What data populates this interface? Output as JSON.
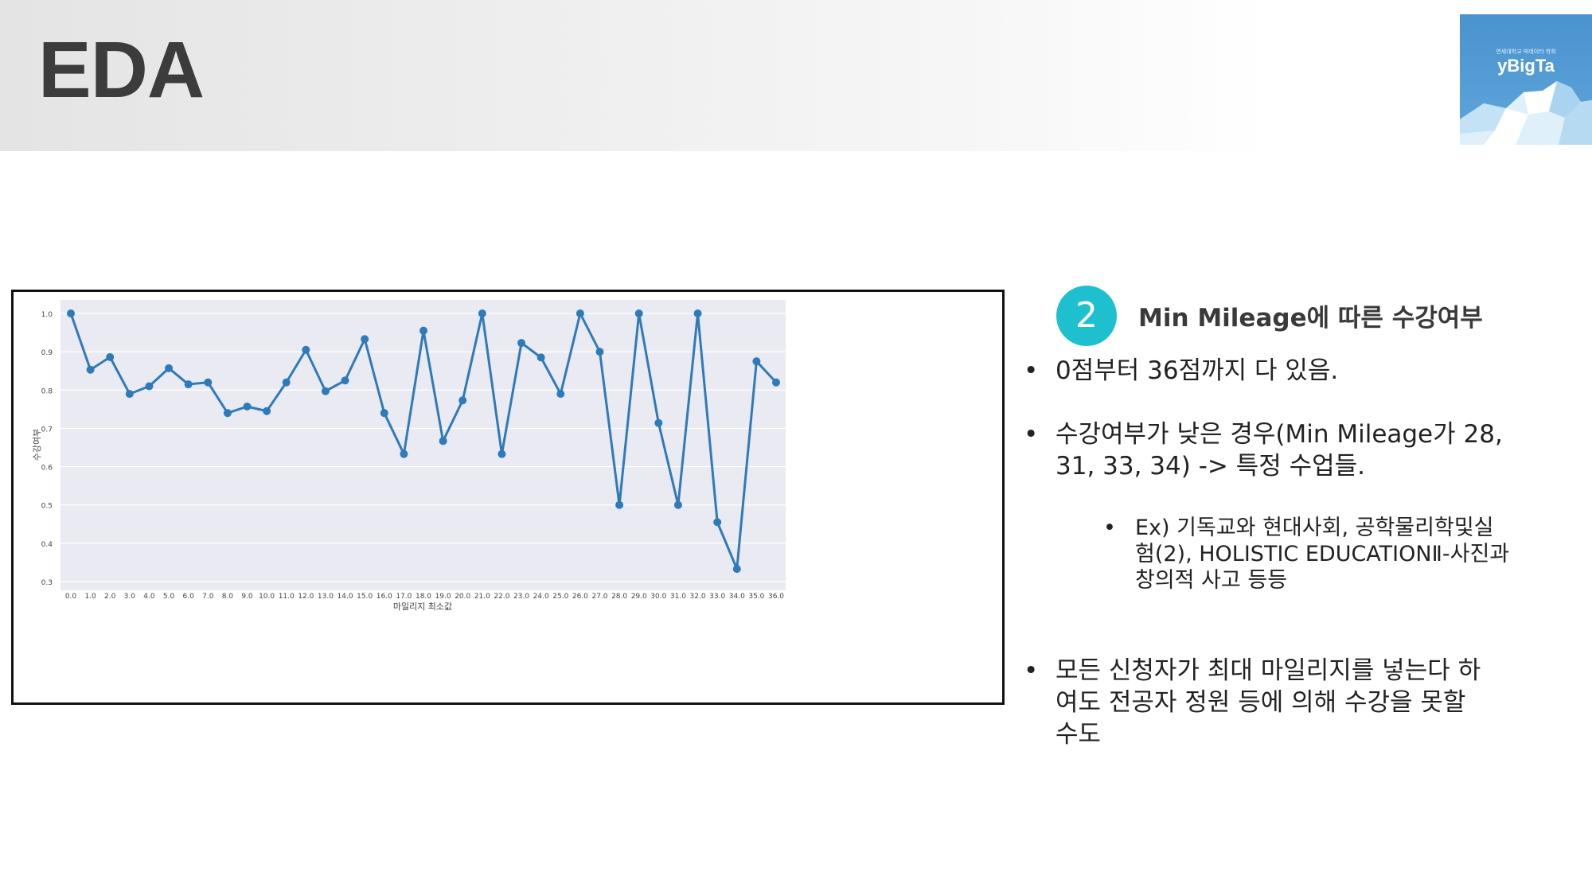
{
  "header": {
    "title": "EDA"
  },
  "logo": {
    "tagline": "연세대학교 빅데이터 학회",
    "name": "yBigTa"
  },
  "colors": {
    "line": "#2f7ab9",
    "plot_bg": "#eaeaf2",
    "accent": "#1ec0cf"
  },
  "section": {
    "number": "2",
    "title": "Min Mileage에 따른 수강여부"
  },
  "bullets": [
    {
      "text": "0점부터 36점까지 다 있음."
    },
    {
      "text": "수강여부가 낮은 경우(Min Mileage가 28,\n31, 33, 34) -> 특정 수업들."
    },
    {
      "text": "Ex) 기독교와 현대사회, 공학물리학및실\n험(2), HOLISTIC EDUCATIONⅡ-사진과\n창의적 사고 등등",
      "level": 2
    },
    {
      "text": "모든 신청자가 최대 마일리지를 넣는다 하\n여도 전공자 정원 등에 의해 수강을 못할\n수도"
    }
  ],
  "chart_data": {
    "type": "line",
    "x": [
      "0.0",
      "1.0",
      "2.0",
      "3.0",
      "4.0",
      "5.0",
      "6.0",
      "7.0",
      "8.0",
      "9.0",
      "10.0",
      "11.0",
      "12.0",
      "13.0",
      "14.0",
      "15.0",
      "16.0",
      "17.0",
      "18.0",
      "19.0",
      "20.0",
      "21.0",
      "22.0",
      "23.0",
      "24.0",
      "25.0",
      "26.0",
      "27.0",
      "28.0",
      "29.0",
      "30.0",
      "31.0",
      "32.0",
      "33.0",
      "34.0",
      "35.0",
      "36.0"
    ],
    "values": [
      1.0,
      0.853,
      0.886,
      0.79,
      0.81,
      0.857,
      0.815,
      0.82,
      0.74,
      0.757,
      0.745,
      0.82,
      0.905,
      0.797,
      0.825,
      0.933,
      0.74,
      0.633,
      0.955,
      0.667,
      0.773,
      1.0,
      0.633,
      0.923,
      0.885,
      0.79,
      1.0,
      0.9,
      0.5,
      1.0,
      0.714,
      0.5,
      1.0,
      0.455,
      0.333,
      0.875,
      0.82
    ],
    "xlabel": "마일리지 최소값",
    "ylabel": "수강여부",
    "ylim": [
      0.3,
      1.0
    ],
    "yticks": [
      "0.3",
      "0.4",
      "0.5",
      "0.6",
      "0.7",
      "0.8",
      "0.9",
      "1.0"
    ],
    "grid": true,
    "markers": true
  }
}
